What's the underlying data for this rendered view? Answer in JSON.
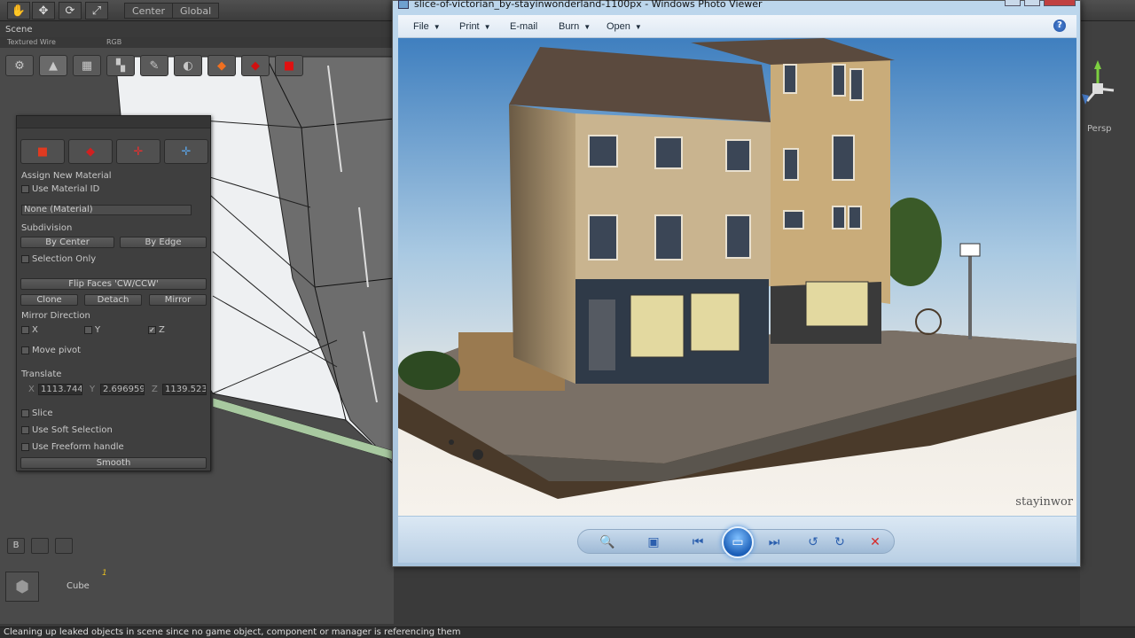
{
  "unity": {
    "pivot_center": "Center",
    "pivot_global": "Global",
    "scene_tab": "Scene",
    "render_mode": "Textured Wire",
    "color_mode": "RGB",
    "persp_label": "Persp",
    "status_message": "Cleaning up leaked objects in scene since no game object, component or manager is referencing them",
    "hierarchy": {
      "b_button": "B",
      "object_name": "Cube",
      "badge": "1"
    }
  },
  "probuilder": {
    "assign_new_material": "Assign New Material",
    "use_material_id": "Use Material ID",
    "material_value": "None (Material)",
    "subdivision": "Subdivision",
    "by_center": "By Center",
    "by_edge": "By Edge",
    "selection_only": "Selection Only",
    "flip_faces": "Flip Faces 'CW/CCW'",
    "clone": "Clone",
    "detach": "Detach",
    "mirror": "Mirror",
    "mirror_direction": "Mirror Direction",
    "axis_x": "X",
    "axis_y": "Y",
    "axis_z": "Z",
    "move_pivot": "Move pivot",
    "translate": "Translate",
    "translate_x": "1113.744",
    "translate_y": "2.696959",
    "translate_z": "1139.523",
    "slice": "Slice",
    "use_soft_selection": "Use Soft Selection",
    "use_freeform_handle": "Use Freeform handle",
    "smooth": "Smooth"
  },
  "photo_viewer": {
    "title": "slice-of-victorian_by-stayinwonderland-1100px - Windows Photo Viewer",
    "menu": [
      "File",
      "Print",
      "E-mail",
      "Burn",
      "Open"
    ],
    "help": "?",
    "watermark": "stayinwor",
    "image_alt": "Slice of Victorian diorama"
  },
  "icons": {
    "hand": "hand-icon",
    "move": "move-icon",
    "rotate": "rotate-icon",
    "scale": "scale-icon",
    "zoom": "zoom-icon",
    "actual_size": "actual-size-icon",
    "previous": "previous-icon",
    "slideshow": "slideshow-icon",
    "next": "next-icon",
    "rotate_ccw": "rotate-ccw-icon",
    "rotate_cw": "rotate-cw-icon",
    "delete": "delete-icon"
  },
  "colors": {
    "unity_bg": "#3a3a3a",
    "viewer_frame": "#bcd6ec",
    "delete_red": "#d62a2a",
    "accent_blue": "#2b5fae"
  }
}
